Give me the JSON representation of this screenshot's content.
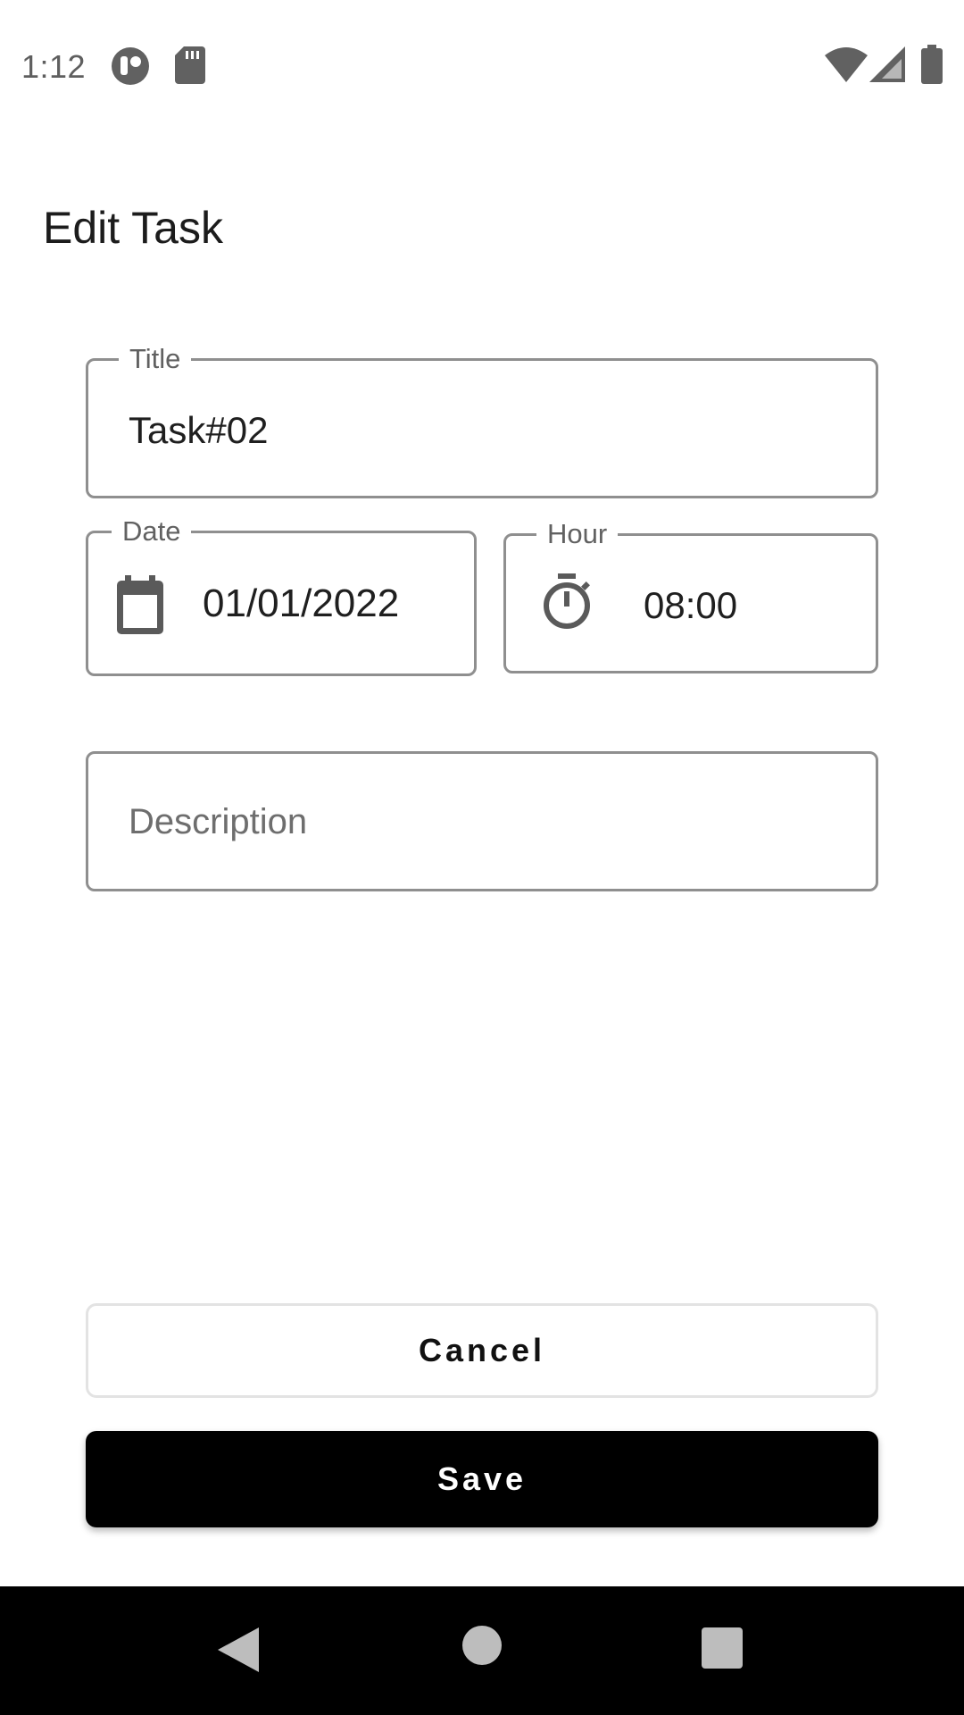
{
  "status_bar": {
    "time": "1:12",
    "icons": [
      "app-notification-icon",
      "sd-card-icon",
      "wifi-icon",
      "cellular-signal-icon",
      "battery-icon"
    ]
  },
  "page": {
    "title": "Edit Task"
  },
  "form": {
    "title_field": {
      "label": "Title",
      "value": "Task#02"
    },
    "date_field": {
      "label": "Date",
      "value": "01/01/2022",
      "icon": "calendar-icon"
    },
    "hour_field": {
      "label": "Hour",
      "value": "08:00",
      "icon": "timer-icon"
    },
    "description_field": {
      "placeholder": "Description",
      "value": ""
    }
  },
  "actions": {
    "cancel_label": "Cancel",
    "save_label": "Save"
  },
  "navigation_bar": {
    "icons": [
      "back-icon",
      "home-icon",
      "recents-icon"
    ]
  },
  "colors": {
    "save_button_bg": "#000000",
    "field_border": "#8f8f8f",
    "nav_bar_bg": "#000000"
  }
}
